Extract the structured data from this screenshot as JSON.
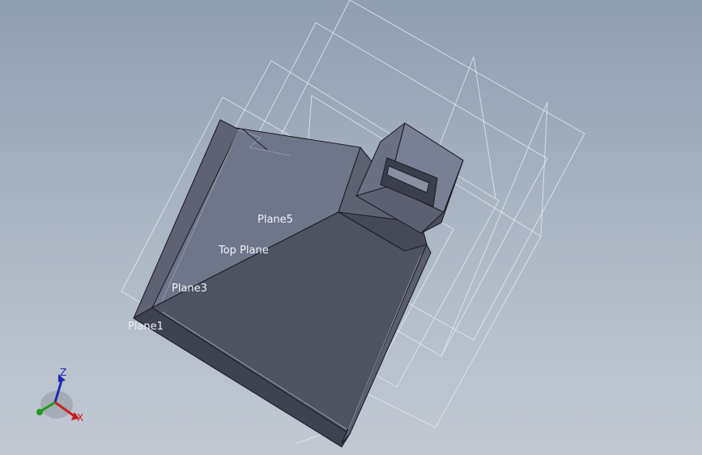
{
  "viewport": {
    "planes": [
      {
        "id": "plane5",
        "label": "Plane5"
      },
      {
        "id": "top-plane",
        "label": "Top Plane"
      },
      {
        "id": "plane3",
        "label": "Plane3"
      },
      {
        "id": "plane1",
        "label": "Plane1"
      }
    ]
  },
  "triad": {
    "x_label": "X",
    "z_label": "Z",
    "colors": {
      "x": "#c81e1e",
      "y": "#1e9a1e",
      "z": "#1e2ab4"
    }
  },
  "colors": {
    "background_top": "#8f9db0",
    "background_bottom": "#c2c9d3",
    "part_face_light": "#70768a",
    "part_face_dark": "#4d515f",
    "plane_outline": "#e8ecf0"
  }
}
